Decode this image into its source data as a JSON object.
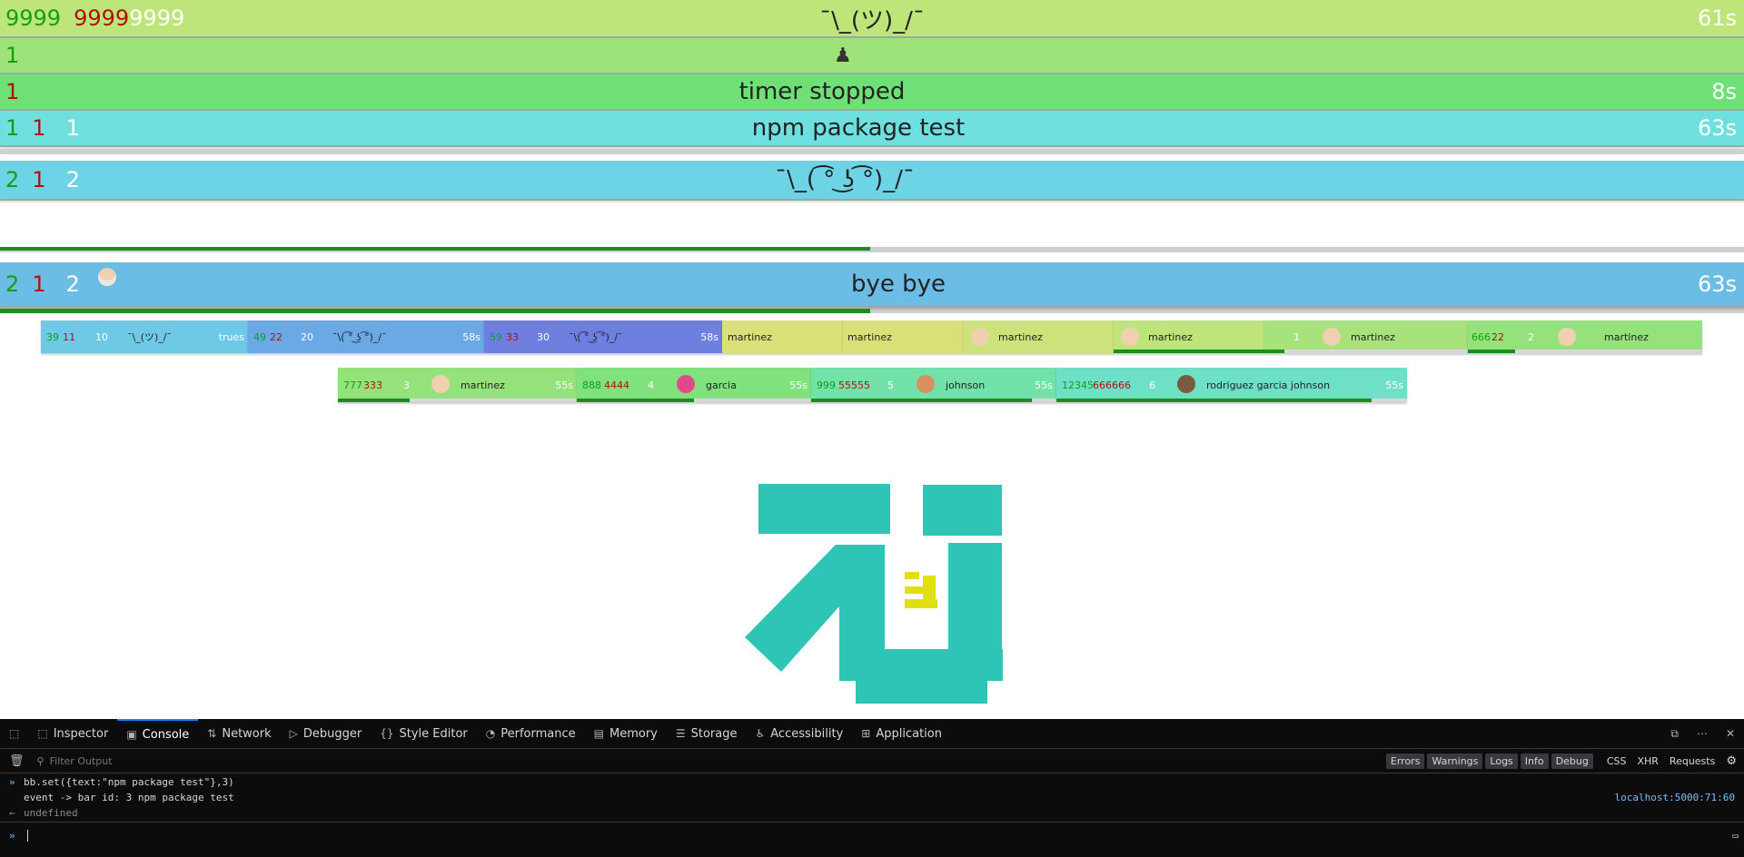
{
  "bars": [
    {
      "n1": "9999",
      "n2": "9999",
      "n3": "9999",
      "text": "¯\\_(ツ)_/¯",
      "time": "61s"
    },
    {
      "n1": "1",
      "text": ""
    },
    {
      "n1": "1",
      "text": "timer stopped",
      "time": "8s"
    },
    {
      "n1": "1",
      "n2": "1",
      "n3": "1",
      "text": "npm package test",
      "time": "63s"
    },
    {
      "n1": "2",
      "n2": "1",
      "n3": "2",
      "text": "¯\\_( ͡° ͜ʖ ͡°)_/¯",
      "progress": 0.5
    },
    {
      "n1": "2",
      "n2": "1",
      "n3": "2",
      "text": "bye bye",
      "time": "63s",
      "progress": 0.5
    }
  ],
  "mini_row1": [
    {
      "n1": "39",
      "n2": "11",
      "n3": "10",
      "text": "¯\\_(ツ)_/¯",
      "time": "trues"
    },
    {
      "n1": "49",
      "n2": "22",
      "n3": "20",
      "text": "¯\\( ͡° ͜ʖ ͡°)_/¯",
      "time": "58s"
    },
    {
      "n1": "59",
      "n2": "33",
      "n3": "30",
      "text": "¯\\( ͡° ͜ʖ ͡°)_/¯",
      "time": "58s"
    },
    {
      "text": "martinez"
    },
    {
      "text": "martinez"
    },
    {
      "text": "martinez"
    },
    {
      "text": "martinez",
      "progress": 1.0
    },
    {
      "n3": "1",
      "text": "martinez",
      "progress": 0.1
    },
    {
      "n1": "666",
      "n2": "22",
      "n3": "2",
      "text": "martinez",
      "progress": 0.2
    }
  ],
  "mini_row2": [
    {
      "n1": "777",
      "n2": "333",
      "n3": "3",
      "text": "martinez",
      "time": "55s",
      "progress": 0.3
    },
    {
      "n1": "888",
      "n2": "4444",
      "n3": "4",
      "text": "garcia",
      "time": "55s",
      "progress": 0.5
    },
    {
      "n1": "999",
      "n2": "55555",
      "n3": "5",
      "text": "johnson",
      "time": "55s",
      "progress": 0.9
    },
    {
      "n1": "12345",
      "n2": "666666",
      "n3": "6",
      "text": "rodriguez garcia johnson",
      "time": "55s",
      "progress": 0.9
    }
  ],
  "devtools": {
    "tabs": [
      "Inspector",
      "Console",
      "Network",
      "Debugger",
      "Style Editor",
      "Performance",
      "Memory",
      "Storage",
      "Accessibility",
      "Application"
    ],
    "filter_placeholder": "Filter Output",
    "levels": [
      "Errors",
      "Warnings",
      "Logs",
      "Info",
      "Debug"
    ],
    "types": [
      "CSS",
      "XHR",
      "Requests"
    ],
    "command": "bb.set({text:\"npm package test\"},3)",
    "log": "event -> bar id: 3 npm package test",
    "log_source": "localhost:5000:71:60",
    "result": "undefined"
  },
  "colors": {
    "accent": "#0a84ff",
    "logo": "#2ec4b6",
    "logo_mark": "#e0e010"
  }
}
